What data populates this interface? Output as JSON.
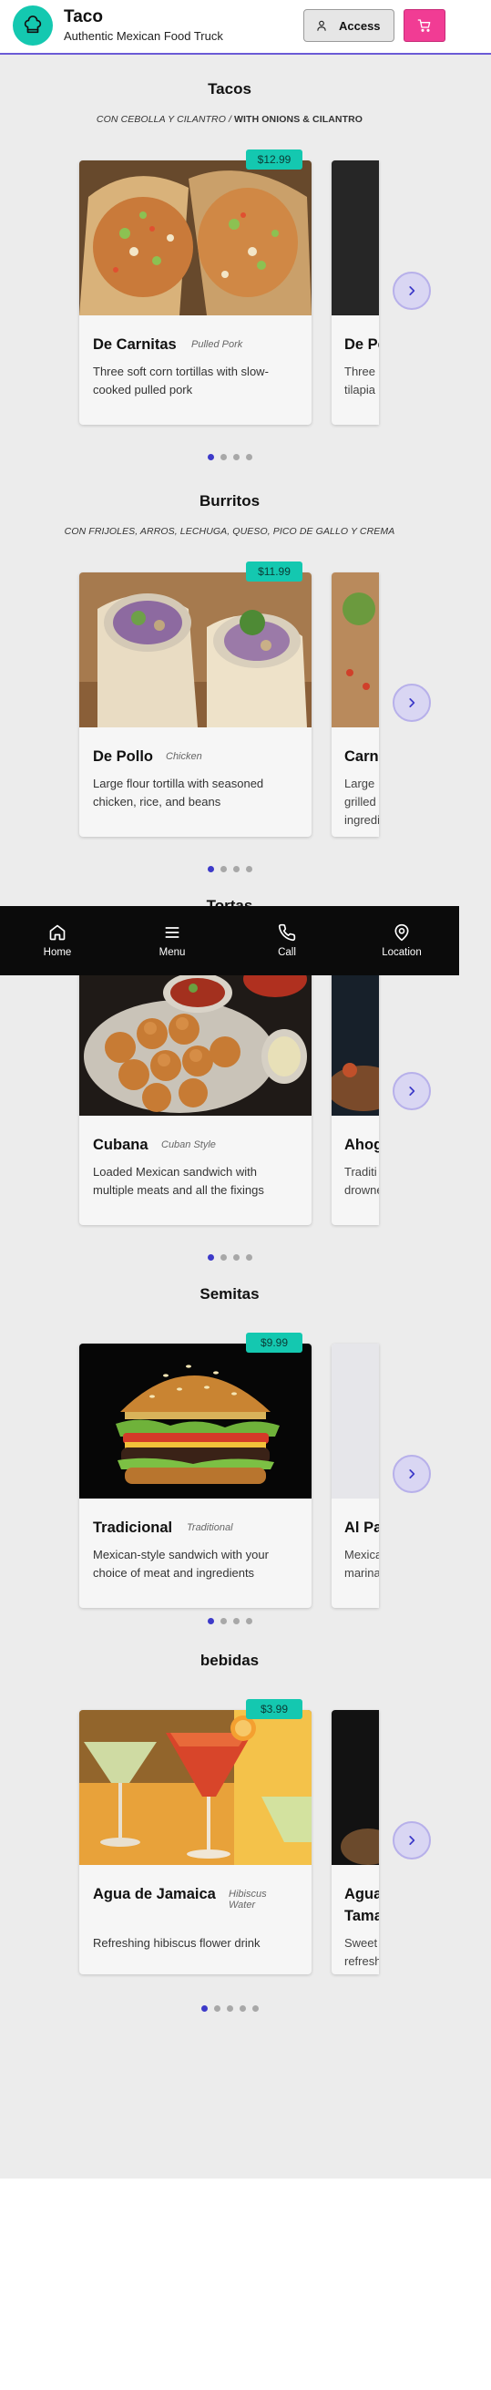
{
  "header": {
    "title": "Taco",
    "subtitle": "Authentic Mexican Food Truck",
    "access_label": "Access"
  },
  "colors": {
    "accent": "#14c8b0",
    "brand_pink": "#f13c94",
    "indigo": "#3d3ac9",
    "nav_bg": "#0b0b0b"
  },
  "sections": [
    {
      "title": "Tacos",
      "subtitle_plain": "CON CEBOLLA Y CILANTRO / ",
      "subtitle_bold": "WITH ONIONS & CILANTRO",
      "card": {
        "name": "De Carnitas",
        "style": "Pulled Pork",
        "description": "Three soft corn tortillas with slow-cooked pulled pork",
        "price": "$12.99"
      },
      "peek": {
        "name": "De Pe",
        "description": "Three",
        "description2": "tilapia"
      },
      "dots": 4,
      "active_dot": 0
    },
    {
      "title": "Burritos",
      "subtitle_plain": "CON FRIJOLES, ARROS, LECHUGA, QUESO, PICO DE GALLO Y CREMA",
      "subtitle_bold": "",
      "card": {
        "name": "De Pollo",
        "style": "Chicken",
        "description": "Large flour tortilla with seasoned chicken, rice, and beans",
        "price": "$11.99"
      },
      "peek": {
        "name": "Carn",
        "description": "Large",
        "description2": "grilled",
        "description3": "ingredi"
      },
      "dots": 4,
      "active_dot": 0
    },
    {
      "title": "Tortas",
      "subtitle_plain": "",
      "subtitle_bold": "",
      "card": {
        "name": "Cubana",
        "style": "Cuban Style",
        "description": "Loaded Mexican sandwich with multiple meats and all the fixings",
        "price": ""
      },
      "peek": {
        "name": "Ahog",
        "description": "Traditi",
        "description2": "drowne"
      },
      "dots": 4,
      "active_dot": 0
    },
    {
      "title": "Semitas",
      "subtitle_plain": "",
      "subtitle_bold": "",
      "card": {
        "name": "Tradicional",
        "style": "Traditional",
        "description": "Mexican-style sandwich with your choice of meat and ingredients",
        "price": "$9.99"
      },
      "peek": {
        "name": "Al Pa",
        "description": "Mexica",
        "description2": "marina"
      },
      "dots": 4,
      "active_dot": 0
    },
    {
      "title": "bebidas",
      "subtitle_plain": "",
      "subtitle_bold": "",
      "card": {
        "name": "Agua de Jamaica",
        "style": "Hibiscus Water",
        "description": "Refreshing hibiscus flower drink",
        "price": "$3.99"
      },
      "peek": {
        "name": "Agua",
        "name2": "Tama",
        "description": "Sweet",
        "description2": "refresh"
      },
      "dots": 5,
      "active_dot": 0
    }
  ],
  "bottom_nav": [
    {
      "label": "Home",
      "icon": "home-icon"
    },
    {
      "label": "Menu",
      "icon": "menu-icon"
    },
    {
      "label": "Call",
      "icon": "phone-icon"
    },
    {
      "label": "Location",
      "icon": "location-icon"
    }
  ]
}
